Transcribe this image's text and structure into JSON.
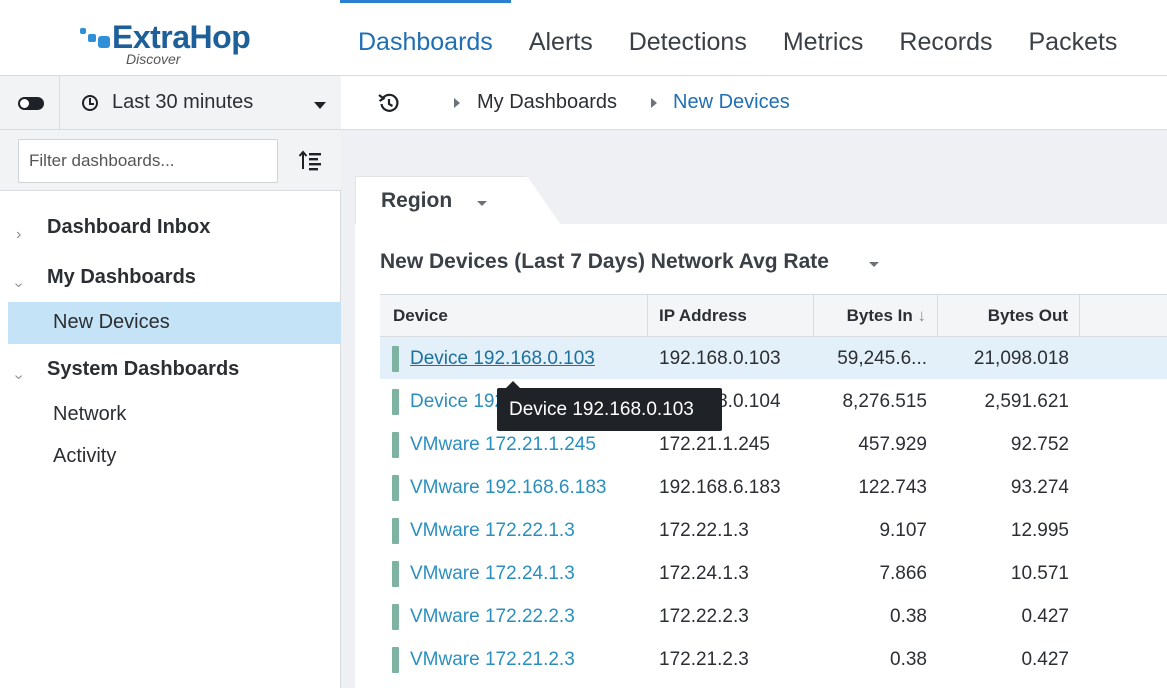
{
  "brand": {
    "name": "ExtraHop",
    "product": "Discover"
  },
  "nav": {
    "tabs": [
      "Dashboards",
      "Alerts",
      "Detections",
      "Metrics",
      "Records",
      "Packets"
    ],
    "active": "Dashboards"
  },
  "sidebar": {
    "time_range": "Last 30 minutes",
    "filter_placeholder": "Filter dashboards...",
    "tree": {
      "inbox": "Dashboard Inbox",
      "my": "My Dashboards",
      "my_items": [
        "New Devices"
      ],
      "system": "System Dashboards",
      "system_items": [
        "Network",
        "Activity"
      ]
    }
  },
  "breadcrumb": [
    "My Dashboards",
    "New Devices"
  ],
  "region": {
    "label": "Region"
  },
  "widget": {
    "title": "New Devices (Last 7 Days) Network Avg Rate",
    "columns": [
      "Device",
      "IP Address",
      "Bytes In",
      "Bytes Out"
    ],
    "sort_indicator": "↓",
    "rows": [
      {
        "device": "Device 192.168.0.103",
        "ip": "192.168.0.103",
        "bytes_in": "59,245.6...",
        "bytes_out": "21,098.018"
      },
      {
        "device": "Device 192.168.0.104",
        "ip": "192.168.0.104",
        "bytes_in": "8,276.515",
        "bytes_out": "2,591.621"
      },
      {
        "device": "VMware 172.21.1.245",
        "ip": "172.21.1.245",
        "bytes_in": "457.929",
        "bytes_out": "92.752"
      },
      {
        "device": "VMware 192.168.6.183",
        "ip": "192.168.6.183",
        "bytes_in": "122.743",
        "bytes_out": "93.274"
      },
      {
        "device": "VMware 172.22.1.3",
        "ip": "172.22.1.3",
        "bytes_in": "9.107",
        "bytes_out": "12.995"
      },
      {
        "device": "VMware 172.24.1.3",
        "ip": "172.24.1.3",
        "bytes_in": "7.866",
        "bytes_out": "10.571"
      },
      {
        "device": "VMware 172.22.2.3",
        "ip": "172.22.2.3",
        "bytes_in": "0.38",
        "bytes_out": "0.427"
      },
      {
        "device": "VMware 172.21.2.3",
        "ip": "172.21.2.3",
        "bytes_in": "0.38",
        "bytes_out": "0.427"
      }
    ]
  },
  "tooltip": {
    "text": "Device 192.168.0.103"
  },
  "colors": {
    "accent": "#1f6fb5",
    "link": "#2a8fbf",
    "selected_bg": "#c4e3f7",
    "device_bar": "#7db3a0"
  },
  "icons": {
    "toggle": "toggle-icon",
    "clock": "clock-icon",
    "sort": "sort-list-icon",
    "history": "history-icon"
  }
}
